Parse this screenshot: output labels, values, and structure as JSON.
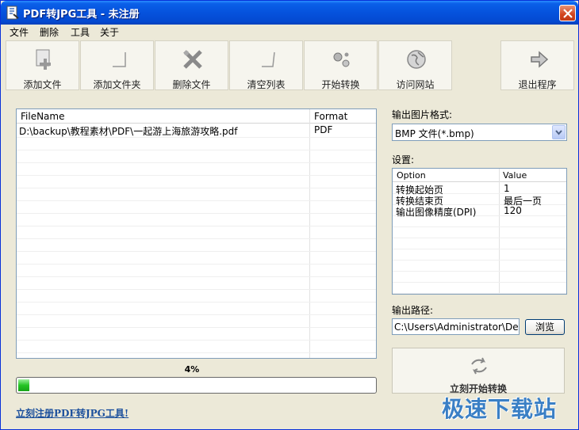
{
  "window": {
    "title": "PDF转JPG工具 - 未注册"
  },
  "menu": [
    "文件",
    "删除",
    "工具",
    "关于"
  ],
  "toolbar": [
    {
      "label": "添加文件",
      "icon": "add-file-icon"
    },
    {
      "label": "添加文件夹",
      "icon": "add-folder-icon"
    },
    {
      "label": "删除文件",
      "icon": "delete-file-icon"
    },
    {
      "label": "清空列表",
      "icon": "clear-list-icon"
    },
    {
      "label": "开始转换",
      "icon": "convert-icon"
    },
    {
      "label": "访问网站",
      "icon": "globe-icon"
    },
    {
      "label": "退出程序",
      "icon": "exit-icon"
    }
  ],
  "file_list": {
    "columns": [
      "FileName",
      "Format"
    ],
    "rows": [
      {
        "filename": "D:\\backup\\教程素材\\PDF\\一起游上海旅游攻略.pdf",
        "format": "PDF"
      }
    ]
  },
  "progress": {
    "percent_label": "4%",
    "value": 0.04
  },
  "register_link": "立刻注册PDF转JPG工具!",
  "output_format": {
    "label": "输出图片格式:",
    "selected": "BMP 文件(*.bmp)"
  },
  "settings": {
    "label": "设置:",
    "columns": [
      "Option",
      "Value"
    ],
    "rows": [
      {
        "option": "转换起始页",
        "value": "1"
      },
      {
        "option": "转换结束页",
        "value": "最后一页"
      },
      {
        "option": "输出图像精度(DPI)",
        "value": "120"
      }
    ]
  },
  "output_path": {
    "label": "输出路径:",
    "value": "C:\\Users\\Administrator\\Desktop",
    "browse_label": "浏览"
  },
  "start_button": {
    "label": "立刻开始转换"
  },
  "watermark": "极速下载站"
}
